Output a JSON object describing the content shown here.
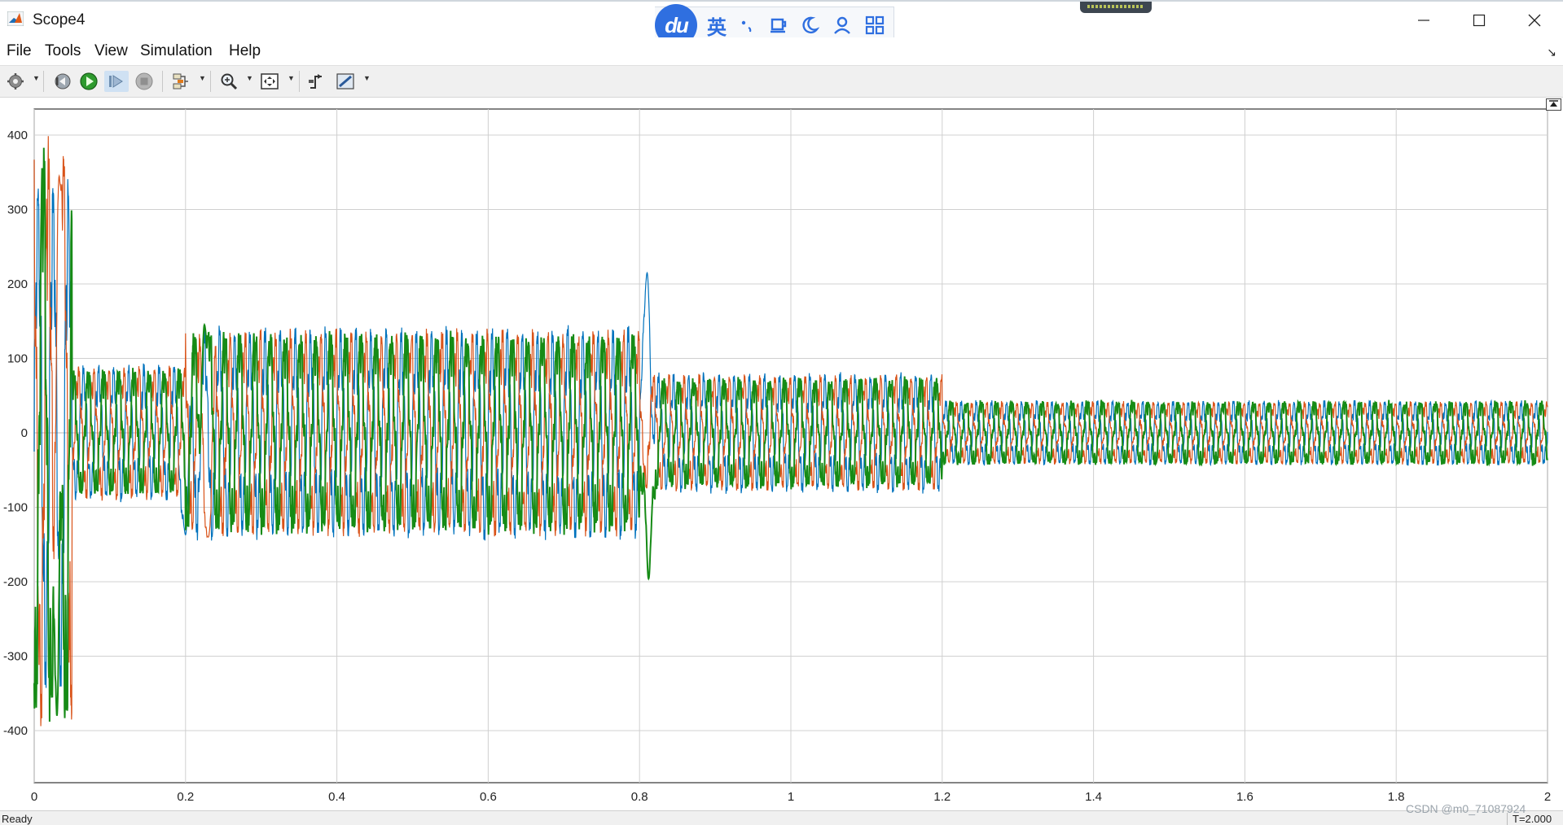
{
  "window": {
    "title": "Scope4"
  },
  "ime": {
    "logo_text": "du",
    "lang_label": "英"
  },
  "menu": [
    {
      "label": "File"
    },
    {
      "label": "Tools"
    },
    {
      "label": "View"
    },
    {
      "label": "Simulation"
    },
    {
      "label": "Help"
    }
  ],
  "toolbar": {
    "icons": [
      "gear-icon",
      "step-back-icon",
      "run-icon",
      "step-forward-icon",
      "stop-icon",
      "signal-select-icon",
      "zoom-icon",
      "fit-to-view-icon",
      "trigger-icon",
      "measure-icon"
    ]
  },
  "chart_data": {
    "type": "line",
    "title": "",
    "xlabel": "",
    "ylabel": "",
    "xlim": [
      0,
      2
    ],
    "ylim": [
      -470,
      435
    ],
    "x_ticks": [
      "0",
      "0.2",
      "0.4",
      "0.6",
      "0.8",
      "1",
      "1.2",
      "1.4",
      "1.6",
      "1.8",
      "2"
    ],
    "y_ticks": [
      "400",
      "300",
      "200",
      "100",
      "0",
      "-100",
      "-200",
      "-300",
      "-400"
    ],
    "grid": true,
    "series": [
      {
        "color": "#0072BD",
        "phase_deg": 0,
        "segments": [
          {
            "t0": 0.0,
            "t1": 0.05,
            "amplitude": 280,
            "note_x": [
              0.005,
              0.03
            ],
            "y": [
              280,
              295
            ]
          },
          {
            "t0": 0.05,
            "t1": 0.2,
            "amplitude": 75
          },
          {
            "t0": 0.2,
            "t1": 0.8,
            "amplitude": 115
          },
          {
            "t0": 0.8,
            "t1": 1.2,
            "amplitude": 65
          },
          {
            "t0": 1.2,
            "t1": 2.0,
            "amplitude": 35
          }
        ],
        "peaks": [
          {
            "x": 0.81,
            "y": 215
          },
          {
            "x": 0.2,
            "y": -137
          }
        ]
      },
      {
        "color": "#D95319",
        "phase_deg": 120,
        "segments": [
          {
            "t0": 0.0,
            "t1": 0.05,
            "amplitude": 330
          },
          {
            "t0": 0.05,
            "t1": 0.2,
            "amplitude": 75
          },
          {
            "t0": 0.2,
            "t1": 0.8,
            "amplitude": 115
          },
          {
            "t0": 0.8,
            "t1": 1.2,
            "amplitude": 65
          },
          {
            "t0": 1.2,
            "t1": 2.0,
            "amplitude": 35
          }
        ],
        "peaks": [
          {
            "x": 0.033,
            "y": 345
          },
          {
            "x": 0.23,
            "y": -140
          }
        ]
      },
      {
        "color": "#168B16",
        "phase_deg": 240,
        "segments": [
          {
            "t0": 0.0,
            "t1": 0.05,
            "amplitude": 340
          },
          {
            "t0": 0.05,
            "t1": 0.2,
            "amplitude": 75
          },
          {
            "t0": 0.2,
            "t1": 0.8,
            "amplitude": 118
          },
          {
            "t0": 0.8,
            "t1": 1.2,
            "amplitude": 65
          },
          {
            "t0": 1.2,
            "t1": 2.0,
            "amplitude": 38
          }
        ],
        "peaks": [
          {
            "x": 0.03,
            "y": -380
          },
          {
            "x": 0.225,
            "y": 145
          },
          {
            "x": 0.812,
            "y": -196
          }
        ]
      }
    ]
  },
  "status": {
    "left": "Ready",
    "right": "T=2.000"
  },
  "watermark": "CSDN @m0_71087924"
}
